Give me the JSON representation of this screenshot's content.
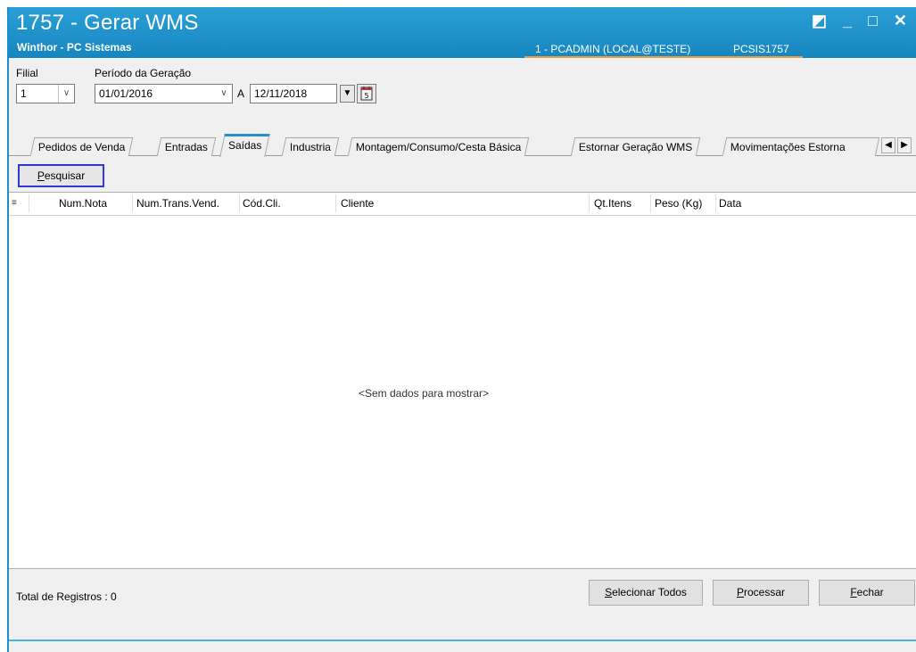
{
  "window": {
    "title": "1757 - Gerar WMS",
    "subtitle": "Winthor - PC Sistemas",
    "user": "1 - PCADMIN (LOCAL@TESTE)",
    "program": "PCSIS1757",
    "controls": [
      "◩",
      "_",
      "□",
      "✕"
    ]
  },
  "filters": {
    "filial_label": "Filial",
    "filial_value": "1",
    "periodo_label": "Período da Geração",
    "date_from": "01/01/2016",
    "range_sep": "A",
    "date_to": "12/11/2018"
  },
  "tabs": [
    {
      "label": "Pedidos de Venda"
    },
    {
      "label": "Entradas"
    },
    {
      "label": "Saídas",
      "active": true
    },
    {
      "label": "Industria"
    },
    {
      "label": "Montagem/Consumo/Cesta Básica"
    },
    {
      "label": "Estornar Geração WMS"
    },
    {
      "label": "Movimentações Estorna"
    }
  ],
  "search_button": {
    "label_underlined": "P",
    "label_rest": "esquisar"
  },
  "grid": {
    "columns": [
      "Num.Nota",
      "Num.Trans.Vend.",
      "Cód.Cli.",
      "Cliente",
      "Qt.Itens",
      "Peso (Kg)",
      "Data"
    ],
    "empty_message": "<Sem dados para mostrar>"
  },
  "footer": {
    "total_label": "Total de Registros : 0",
    "select_all": {
      "u": "S",
      "rest": "elecionar Todos"
    },
    "process": {
      "u": "P",
      "rest": "rocessar"
    },
    "close": {
      "u": "F",
      "rest": "echar"
    }
  },
  "colors": {
    "title_bar": "#1d8ac6",
    "accent_underline": "#e8a13b",
    "search_border": "#2f39d6"
  }
}
